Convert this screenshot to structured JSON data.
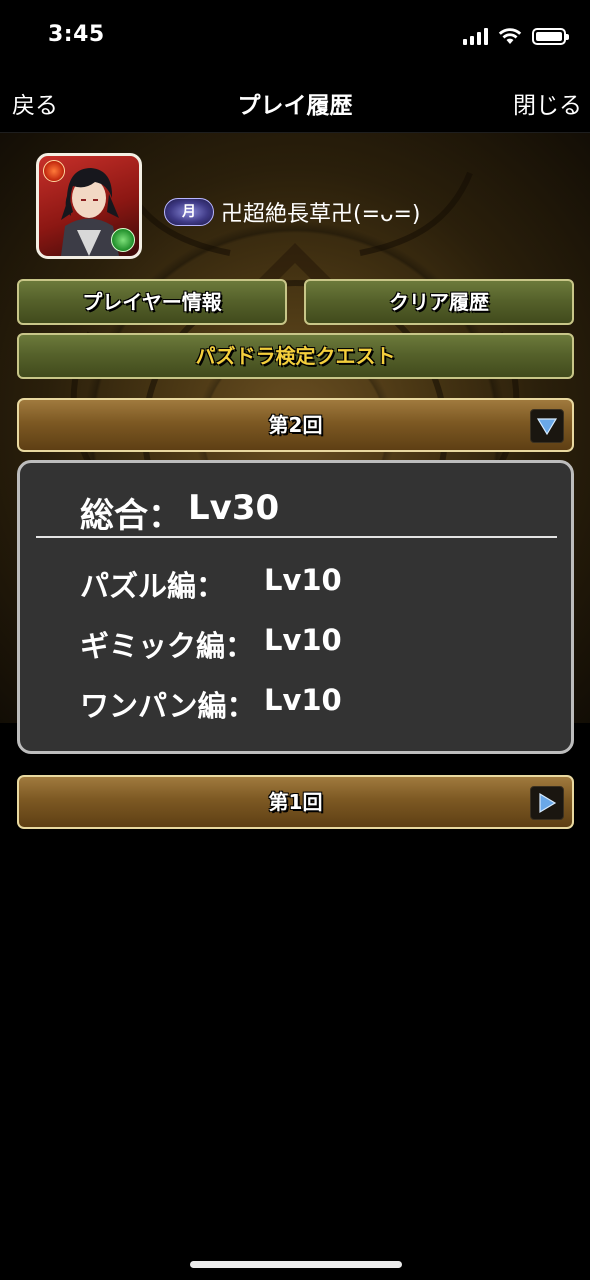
{
  "status_bar": {
    "time": "3:45",
    "battery_level": 1.0,
    "signal_bars": 4
  },
  "nav": {
    "back_label": "戻る",
    "title": "プレイ履歴",
    "close_label": "閉じる"
  },
  "player": {
    "rank_badge": "月",
    "name": "卍超絶長草卍(=ᴗ=)"
  },
  "buttons": {
    "player_info": "プレイヤー情報",
    "clear_history": "クリア履歴",
    "quest": "パズドラ検定クエスト"
  },
  "rounds": [
    {
      "label": "第2回",
      "expanded": true
    },
    {
      "label": "第1回",
      "expanded": false
    }
  ],
  "result": {
    "total_label": "総合：",
    "total_value": "Lv30",
    "rows": [
      {
        "label": "パズル編：",
        "value": "Lv10"
      },
      {
        "label": "ギミック編：",
        "value": "Lv10"
      },
      {
        "label": "ワンパン編：",
        "value": "Lv10"
      }
    ]
  },
  "colors": {
    "quest_text": "#f4cf3c",
    "green_button": "#56622b",
    "brown_bar": "#7d5923",
    "panel_bg": "#333333"
  },
  "icons": [
    "signal-icon",
    "wifi-icon",
    "battery-icon",
    "fire-attribute-icon",
    "wood-attribute-icon",
    "collapse-triangle-icon",
    "expand-triangle-icon"
  ]
}
